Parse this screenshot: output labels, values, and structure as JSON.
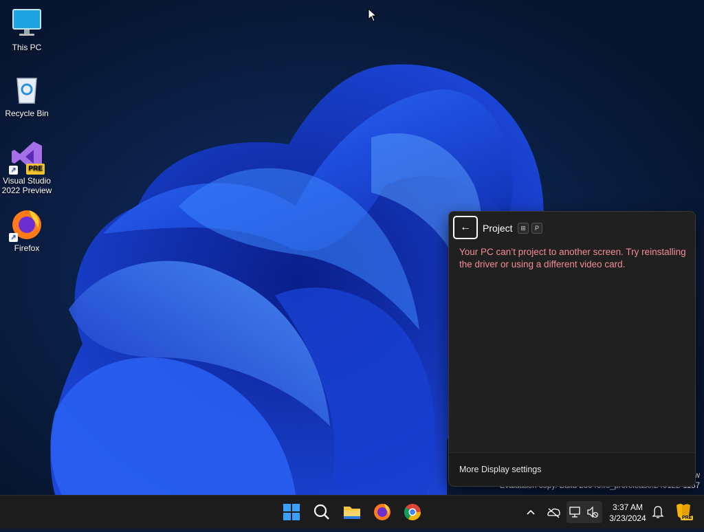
{
  "desktop": {
    "icons": [
      {
        "label": "This PC"
      },
      {
        "label": "Recycle Bin"
      },
      {
        "label": "Visual Studio\n2022 Preview",
        "badge": "PRE"
      },
      {
        "label": "Firefox"
      }
    ]
  },
  "project_flyout": {
    "title": "Project",
    "shortcut_keys": [
      "⊞",
      "P"
    ],
    "error_message": "Your PC can’t project to another screen. Try reinstalling the driver or using a different video card.",
    "footer_link": "More Display settings"
  },
  "watermark": {
    "line1": "w",
    "line2": "Evaluation copy. Build 26040.rs_prerelease.240122-1157"
  },
  "taskbar": {
    "apps": [
      "Start",
      "Search",
      "File Explorer",
      "Firefox",
      "Chrome"
    ],
    "clock": {
      "time": "3:37 AM",
      "date": "3/23/2024"
    },
    "copilot_badge": "PRE"
  },
  "colors": {
    "error_text": "#f28b96",
    "flyout_bg": "#202020",
    "taskbar_bg": "#1c1c1c",
    "accent": "#1f6feb"
  }
}
